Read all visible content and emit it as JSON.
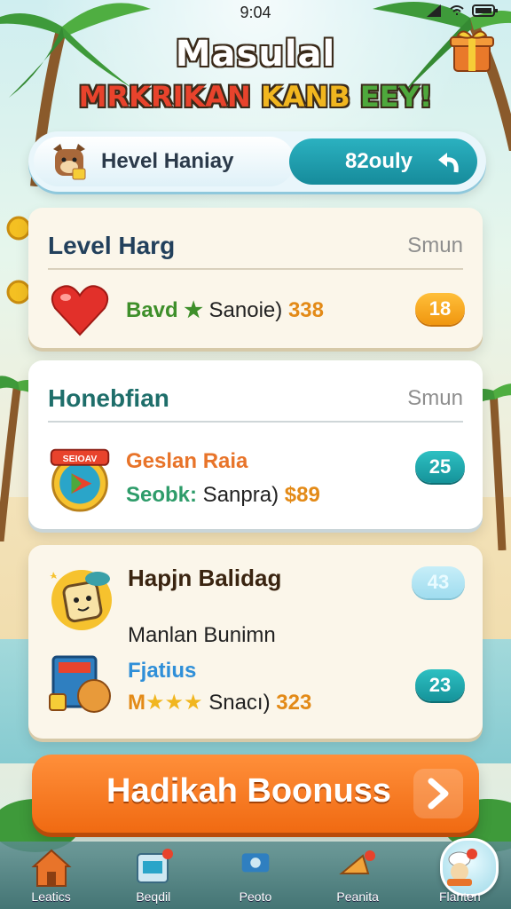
{
  "status": {
    "time": "9:04"
  },
  "header": {
    "title": "Masulal",
    "subtitle_part1": "MRKRIKAN ",
    "subtitle_part2": "KANB",
    "subtitle_part3": " EEY!"
  },
  "tabs": {
    "left_label": "Hevel Haniay",
    "right_label": "82ouly"
  },
  "cards": [
    {
      "title": "Level Harg",
      "side": "Smun",
      "row": {
        "prefix": "Bavd",
        "star": "★",
        "mid": " Sanoie)",
        "value": "338"
      },
      "badge": "18"
    },
    {
      "title": "Honebfian",
      "side": "Smun",
      "icon_text": "SEIOAV",
      "line1": "Geslan Raia",
      "line2_prefix": "Seobk:",
      "line2_mid": " Sanpra)",
      "line2_value": "$89",
      "badge": "25"
    },
    {
      "title": "Hapjn Balidag",
      "line1": "Manlan Bunimn",
      "line2": "Fjatius",
      "line3_prefix": "M",
      "line3_stars": "★★★",
      "line3_mid": " Snacı)",
      "line3_value": "323",
      "badge_top": "43",
      "badge_bottom": "23"
    }
  ],
  "cta": {
    "label": "Hadikah Boonuss"
  },
  "nav": [
    {
      "label": "Leatics",
      "icon": "house-icon"
    },
    {
      "label": "Beqdil",
      "icon": "tablet-icon"
    },
    {
      "label": "Peoto",
      "icon": "camera-icon"
    },
    {
      "label": "Peanita",
      "icon": "horn-icon"
    },
    {
      "label": "Flanten",
      "icon": "chef-icon"
    }
  ],
  "colors": {
    "orange_button": "#f06a12",
    "teal": "#168b9b",
    "card_bg": "#fbf6ea"
  }
}
